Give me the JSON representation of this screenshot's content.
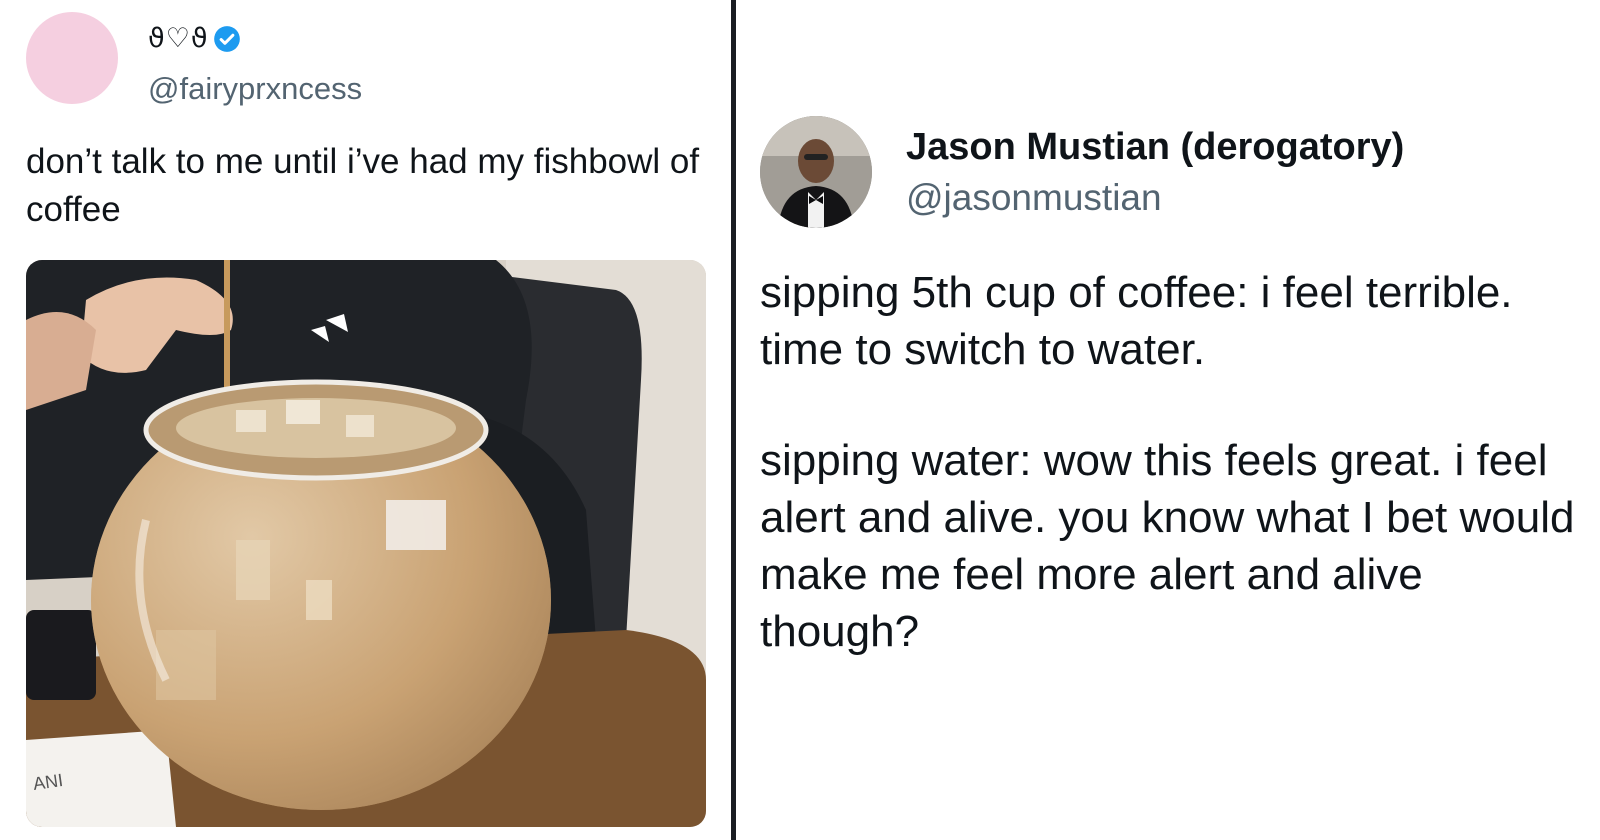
{
  "left_tweet": {
    "display_name_glyphs": "ϑ♡ϑ",
    "verified": true,
    "handle": "@fairyprxncess",
    "text": "don’t talk to me until i’ve had my fishbowl of coffee",
    "media_caption_fragment": "ANI"
  },
  "right_tweet": {
    "display_name": "Jason Mustian (derogatory)",
    "handle": "@jasonmustian",
    "paragraph_1": "sipping 5th cup of coffee: i feel terrible. time to switch to water.",
    "paragraph_2": "sipping water: wow this feels great. i feel alert and alive. you know what I bet would make me feel more alert and alive though?"
  },
  "colors": {
    "verified_badge": "#1d9bf0",
    "handle_gray": "#536471",
    "text": "#0f1419",
    "divider": "#1a1d22",
    "left_avatar": "#f5cfe0"
  },
  "icons": {
    "verified": "verified-badge-icon"
  }
}
